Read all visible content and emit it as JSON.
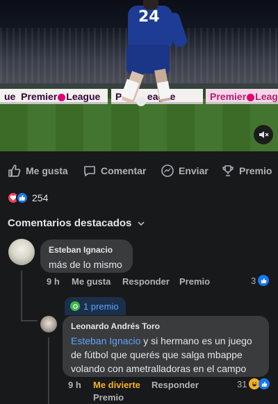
{
  "video": {
    "player_number": "24",
    "boards": [
      "Premier",
      "League",
      "Pre",
      "eague",
      "Premier",
      "Leag"
    ],
    "left_fragment": "ue"
  },
  "actions": {
    "like": "Me gusta",
    "comment": "Comentar",
    "send": "Enviar",
    "award": "Premio"
  },
  "reactions": {
    "count": "254"
  },
  "comments_section": {
    "title": "Comentarios destacados"
  },
  "comments": [
    {
      "author": "Esteban Ignacio",
      "text": "más de lo mismo",
      "time": "9 h",
      "like_label": "Me gusta",
      "reply_label": "Responder",
      "award_label": "Premio",
      "reaction_count": "3"
    },
    {
      "badge": "1 premio",
      "author": "Leonardo Andrés Toro",
      "mention": "Esteban Ignacio",
      "text_line1": " y si hermano es un juego",
      "text_line2": "de fútbol que querés que salga mbappe",
      "text_line3": "volando con ametralladoras en el campo",
      "time": "9 h",
      "like_label": "Me divierte",
      "reply_label": "Responder",
      "award_label": "Premio",
      "reaction_count": "31"
    }
  ],
  "colors": {
    "background": "#18191a",
    "bubble": "#3a3b3c",
    "accent_blue": "#5fa3ff",
    "laugh_yellow": "#f7b125",
    "like_blue": "#1877f2",
    "heart_red": "#f33e58"
  }
}
